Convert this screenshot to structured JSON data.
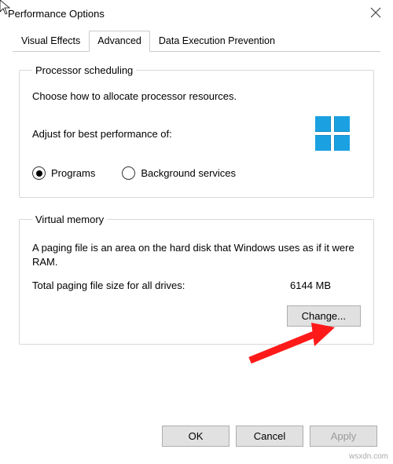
{
  "window": {
    "title": "Performance Options"
  },
  "tabs": {
    "visual_effects": "Visual Effects",
    "advanced": "Advanced",
    "dep": "Data Execution Prevention"
  },
  "processor": {
    "legend": "Processor scheduling",
    "info": "Choose how to allocate processor resources.",
    "adjust_label": "Adjust for best performance of:",
    "programs": "Programs",
    "bg_services": "Background services"
  },
  "vm": {
    "legend": "Virtual memory",
    "desc": "A paging file is an area on the hard disk that Windows uses as if it were RAM.",
    "size_label": "Total paging file size for all drives:",
    "size_value": "6144 MB",
    "change": "Change..."
  },
  "buttons": {
    "ok": "OK",
    "cancel": "Cancel",
    "apply": "Apply"
  },
  "watermark": "wsxdn.com"
}
